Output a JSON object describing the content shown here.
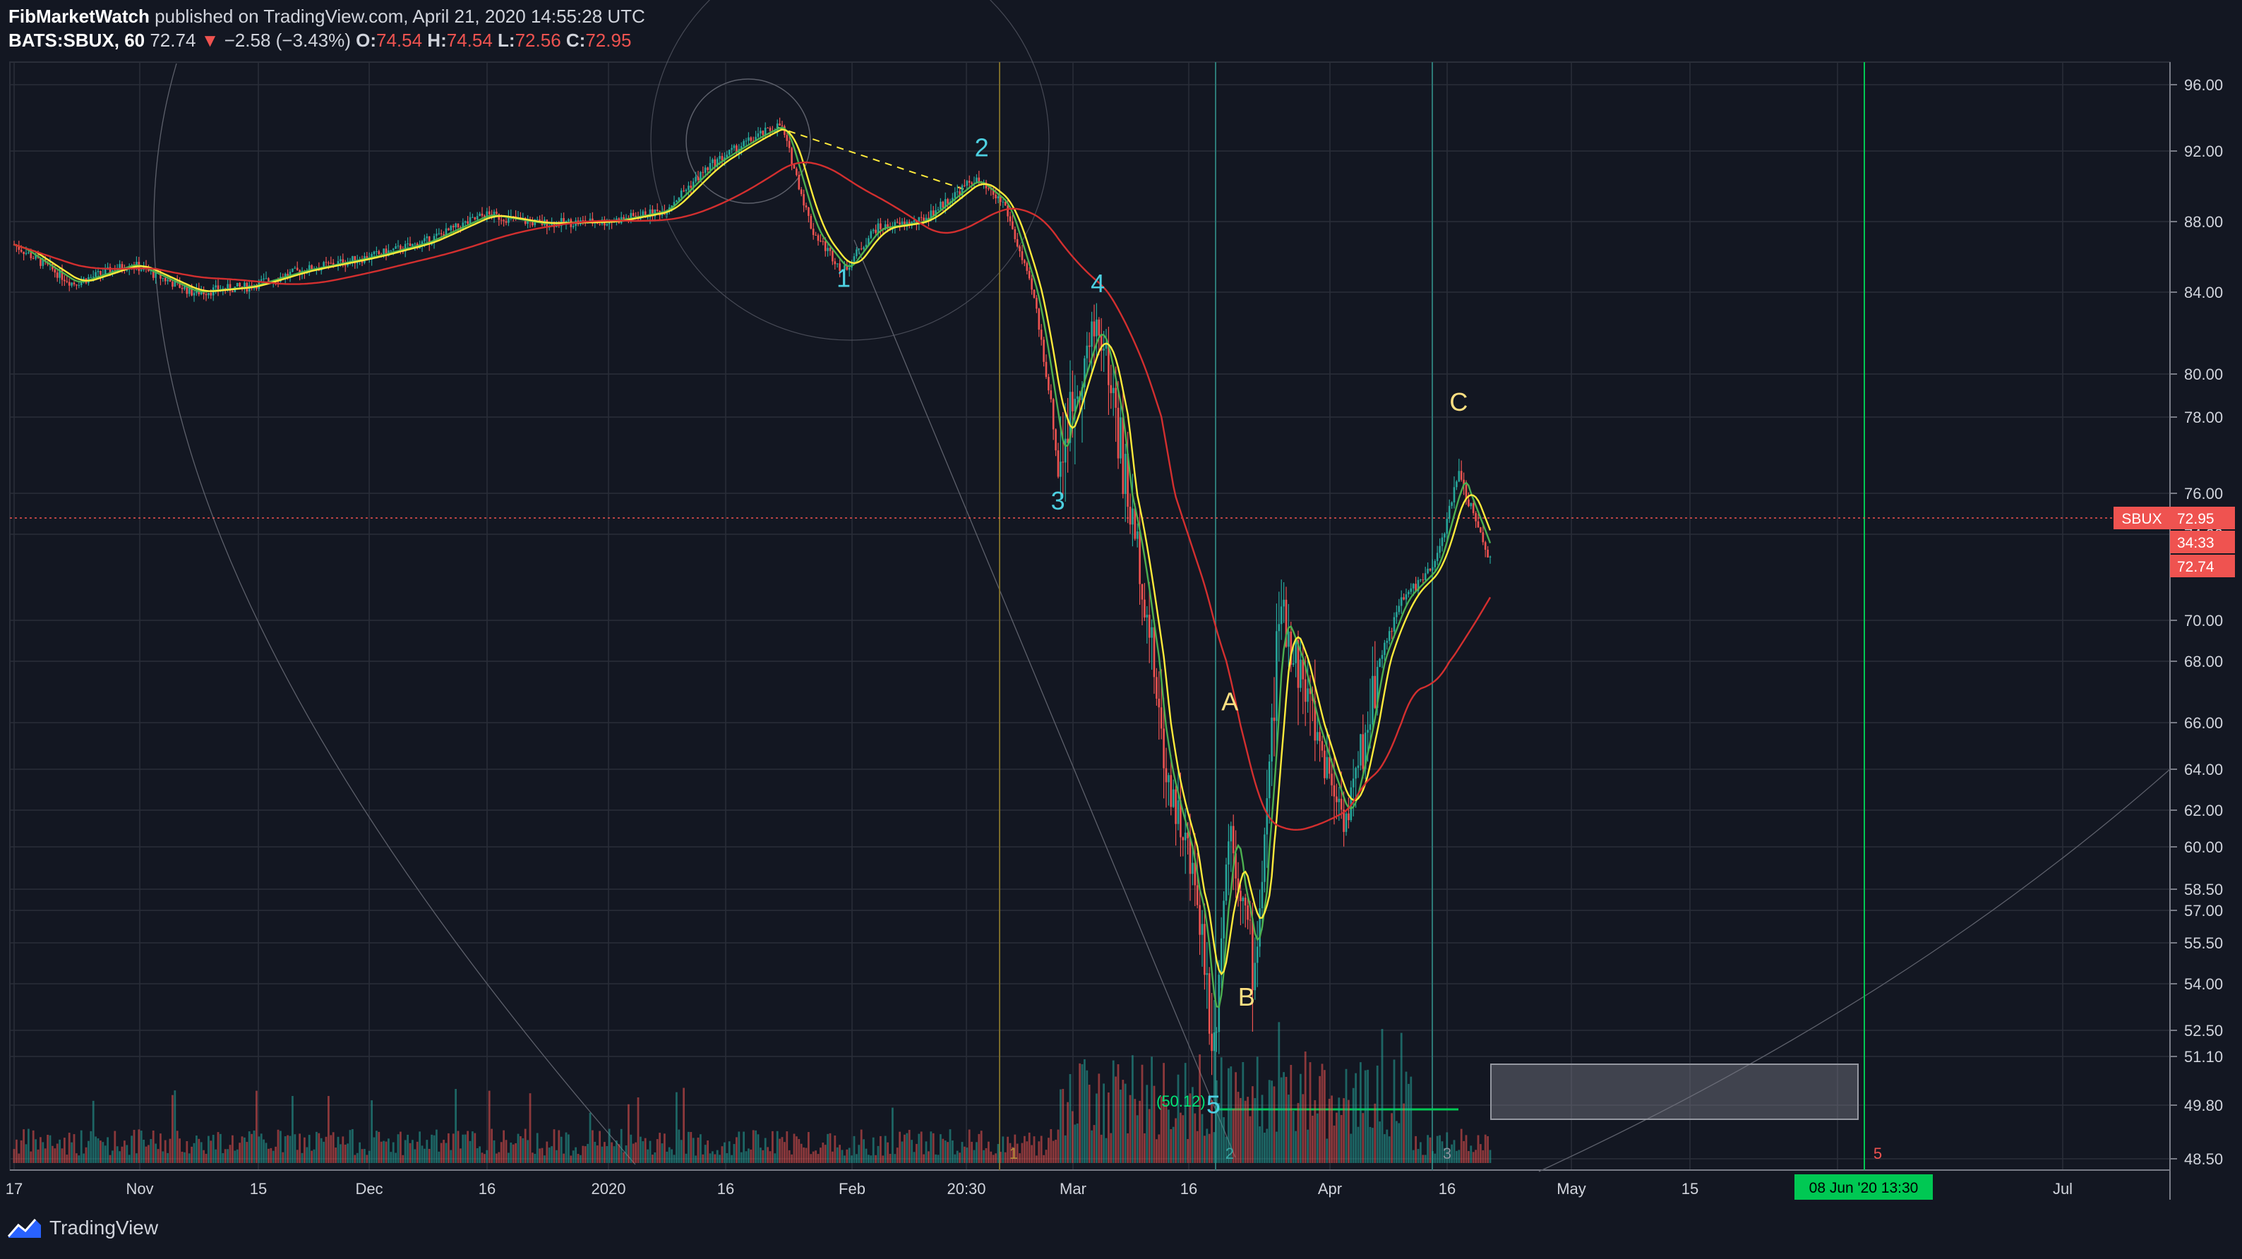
{
  "header": {
    "author": "FibMarketWatch",
    "published_text": " published on TradingView.com, April 21, 2020 14:55:28 UTC",
    "symbol": "BATS:SBUX, 60",
    "last": "72.74",
    "arrow": "▼",
    "change": "−2.58 (−3.43%)",
    "o_label": "O:",
    "o_val": "74.54",
    "h_label": "H:",
    "h_val": "74.54",
    "l_label": "L:",
    "l_val": "72.56",
    "c_label": "C:",
    "c_val": "72.95"
  },
  "footer": {
    "brand": "TradingView"
  },
  "colors": {
    "background": "#131722",
    "grid": "#2a2e39",
    "up": "#26a69a",
    "down": "#ef5350",
    "ema_fast": "#4caf50",
    "ema_slow": "#ffeb3b",
    "ma_long": "#d32f2f",
    "wave_impulse": "#4dd0e1",
    "wave_corrective": "#ffe082",
    "highlight": "#00c853"
  },
  "chart_data": {
    "type": "candlestick",
    "symbol": "SBUX",
    "interval": "60",
    "ylim": [
      48.5,
      96.0
    ],
    "y_ticks": [
      "96.00",
      "92.00",
      "88.00",
      "84.00",
      "80.00",
      "78.00",
      "76.00",
      "74.00",
      "70.00",
      "68.00",
      "66.00",
      "64.00",
      "62.00",
      "60.00",
      "58.50",
      "57.00",
      "55.50",
      "54.00",
      "52.50",
      "51.10",
      "49.80",
      "48.50"
    ],
    "x_ticks": [
      "17",
      "Nov",
      "15",
      "Dec",
      "16",
      "2020",
      "16",
      "Feb",
      "20:30",
      "Mar",
      "16",
      "Apr",
      "16",
      "May",
      "15",
      "Jun",
      "Jul"
    ],
    "price_path": [
      {
        "x": "Oct 17",
        "y": 86.7
      },
      {
        "x": "Oct 24",
        "y": 84.5
      },
      {
        "x": "Oct 31",
        "y": 85.6
      },
      {
        "x": "Nov 8",
        "y": 84.0
      },
      {
        "x": "Nov 15",
        "y": 84.3
      },
      {
        "x": "Nov 22",
        "y": 85.2
      },
      {
        "x": "Dec 1",
        "y": 86.0
      },
      {
        "x": "Dec 8",
        "y": 86.8
      },
      {
        "x": "Dec 16",
        "y": 88.4
      },
      {
        "x": "Dec 23",
        "y": 87.9
      },
      {
        "x": "Jan 1",
        "y": 88.0
      },
      {
        "x": "Jan 8",
        "y": 88.6
      },
      {
        "x": "Jan 14",
        "y": 91.2
      },
      {
        "x": "Jan 20",
        "y": 92.9
      },
      {
        "x": "Jan 23",
        "y": 93.6
      },
      {
        "x": "Jan 27",
        "y": 87.5
      },
      {
        "x": "Jan 31",
        "y": 85.2
      },
      {
        "x": "Feb 4",
        "y": 87.6
      },
      {
        "x": "Feb 10",
        "y": 88.0
      },
      {
        "x": "Feb 17",
        "y": 90.4
      },
      {
        "x": "Feb 21",
        "y": 89.0
      },
      {
        "x": "Feb 25",
        "y": 83.5
      },
      {
        "x": "Feb 28",
        "y": 76.5
      },
      {
        "x": "Mar 4",
        "y": 82.6
      },
      {
        "x": "Mar 9",
        "y": 73.0
      },
      {
        "x": "Mar 12",
        "y": 64.5
      },
      {
        "x": "Mar 16",
        "y": 58.0
      },
      {
        "x": "Mar 18",
        "y": 51.5
      },
      {
        "x": "Mar 20",
        "y": 61.5
      },
      {
        "x": "Mar 23",
        "y": 54.2
      },
      {
        "x": "Mar 26",
        "y": 70.5
      },
      {
        "x": "Mar 31",
        "y": 65.0
      },
      {
        "x": "Apr 3",
        "y": 61.5
      },
      {
        "x": "Apr 7",
        "y": 68.0
      },
      {
        "x": "Apr 10",
        "y": 71.0
      },
      {
        "x": "Apr 14",
        "y": 72.5
      },
      {
        "x": "Apr 17",
        "y": 76.8
      },
      {
        "x": "Apr 21",
        "y": 72.74
      }
    ],
    "last_price": 72.95,
    "price_labels": [
      {
        "text": "SBUX",
        "value": "72.95"
      },
      {
        "text": "34:33"
      },
      {
        "text": "72.74"
      }
    ],
    "wave_labels": [
      {
        "text": "1",
        "x": "Jan 31",
        "y": 84.3,
        "kind": "impulse"
      },
      {
        "text": "2",
        "x": "Feb 18",
        "y": 91.7,
        "kind": "impulse"
      },
      {
        "text": "4",
        "x": "Mar 4",
        "y": 84.0,
        "kind": "impulse"
      },
      {
        "text": "3",
        "x": "Feb 28",
        "y": 75.2,
        "kind": "impulse"
      },
      {
        "text": "5",
        "x": "Mar 18",
        "y": 49.6,
        "kind": "impulse"
      },
      {
        "text": "A",
        "x": "Mar 20",
        "y": 66.4,
        "kind": "corrective"
      },
      {
        "text": "B",
        "x": "Mar 22",
        "y": 53.3,
        "kind": "corrective"
      },
      {
        "text": "C",
        "x": "Apr 17",
        "y": 78.3,
        "kind": "corrective"
      }
    ],
    "annotations": [
      {
        "text": "(50.12)",
        "kind": "fib_level"
      },
      {
        "text": "08 Jun '20   13:30",
        "kind": "date_marker"
      },
      {
        "text": "1",
        "kind": "cycle_marker"
      },
      {
        "text": "2",
        "kind": "cycle_marker"
      },
      {
        "text": "3",
        "kind": "cycle_marker"
      },
      {
        "text": "5",
        "kind": "cycle_marker"
      }
    ]
  }
}
